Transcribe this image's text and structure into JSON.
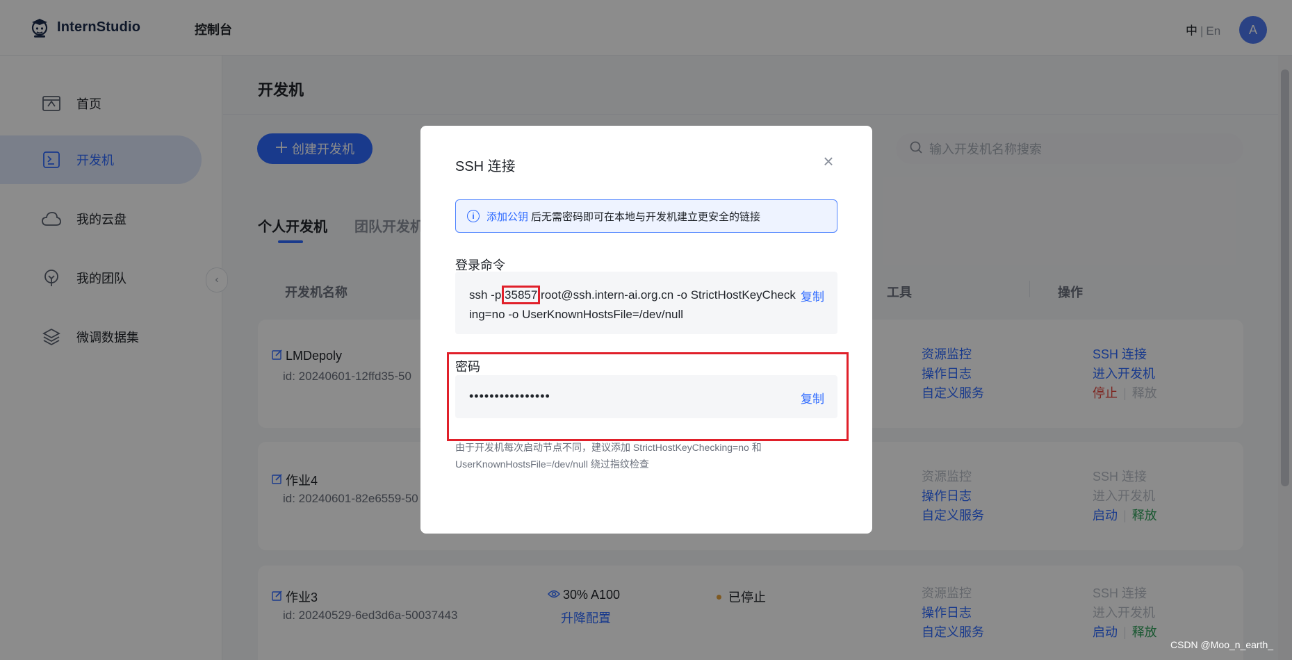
{
  "header": {
    "brand": "InternStudio",
    "console": "控制台",
    "lang_zh": "中",
    "lang_sep": "|",
    "lang_en": "En",
    "avatar_letter": "A"
  },
  "sidebar": {
    "items": [
      {
        "label": "首页",
        "icon": "home-icon"
      },
      {
        "label": "开发机",
        "icon": "terminal-icon"
      },
      {
        "label": "我的云盘",
        "icon": "cloud-icon"
      },
      {
        "label": "我的团队",
        "icon": "team-icon"
      },
      {
        "label": "微调数据集",
        "icon": "dataset-icon"
      }
    ],
    "collapse_glyph": "‹"
  },
  "main": {
    "title": "开发机",
    "create_button": "创建开发机",
    "search_placeholder": "输入开发机名称搜索",
    "tabs": {
      "personal": "个人开发机",
      "team": "团队开发机"
    },
    "columns": {
      "name": "开发机名称",
      "tools": "工具",
      "actions": "操作"
    },
    "rows": [
      {
        "name": "LMDepoly",
        "id": "id: 20240601-12ffd35-50",
        "tools": [
          "资源监控",
          "操作日志",
          "自定义服务"
        ],
        "actions": {
          "ssh": "SSH 连接",
          "enter": "进入开发机",
          "primary": "停止",
          "secondary": "释放"
        }
      },
      {
        "name": "作业4",
        "id": "id: 20240601-82e6559-50",
        "tools": [
          "资源监控",
          "操作日志",
          "自定义服务"
        ],
        "actions": {
          "ssh": "SSH 连接",
          "enter": "进入开发机",
          "primary": "启动",
          "secondary": "释放"
        }
      },
      {
        "name": "作业3",
        "id": "id: 20240529-6ed3d6a-50037443",
        "spec": "30% A100",
        "upgrade": "升降配置",
        "status": "已停止",
        "tools": [
          "资源监控",
          "操作日志",
          "自定义服务"
        ],
        "actions": {
          "ssh": "SSH 连接",
          "enter": "进入开发机",
          "primary": "启动",
          "secondary": "释放"
        }
      }
    ]
  },
  "modal": {
    "title": "SSH 连接",
    "close_glyph": "×",
    "info_link": "添加公钥",
    "info_text": "后无需密码即可在本地与开发机建立更安全的链接",
    "login_label": "登录命令",
    "cmd_prefix": "ssh -p ",
    "cmd_port": "35857",
    "cmd_rest": " root@ssh.intern-ai.org.cn -o StrictHostKeyChecking=no -o UserKnownHostsFile=/dev/null",
    "copy_label": "复制",
    "password_label": "密码",
    "password_mask": "••••••••••••••••",
    "note": "由于开发机每次启动节点不同，建议添加 StrictHostKeyChecking=no 和 UserKnownHostsFile=/dev/null 绕过指纹检查"
  },
  "watermark": "CSDN @Moo_n_earth_",
  "colors": {
    "accent": "#2f6bff",
    "highlight": "#e0202a",
    "danger": "#e5483f",
    "success": "#2fa05a",
    "warning": "#e6a23c"
  }
}
